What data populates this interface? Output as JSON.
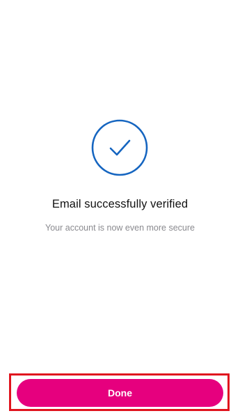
{
  "verification": {
    "icon": "checkmark-circle-icon",
    "icon_color": "#1565c0",
    "title": "Email successfully verified",
    "subtitle": "Your account is now even more secure"
  },
  "actions": {
    "done_label": "Done",
    "done_color": "#e6007e",
    "highlight_color": "#e0141e"
  }
}
